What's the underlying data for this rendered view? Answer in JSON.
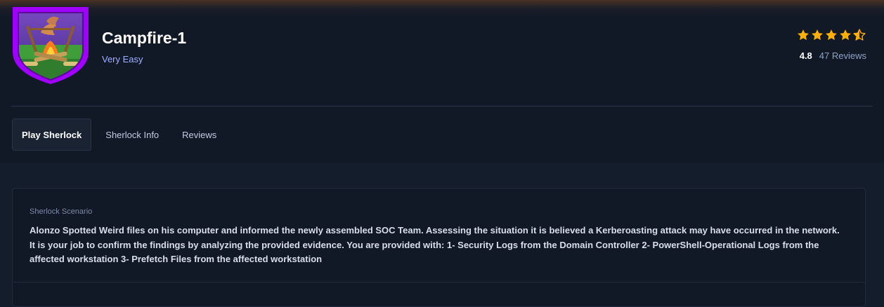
{
  "machine": {
    "title": "Campfire-1",
    "difficulty": "Very Easy",
    "rating": "4.8",
    "reviews": "47 Reviews",
    "stars": 4.5,
    "badge_icon": "campfire-badge-icon"
  },
  "tabs": [
    {
      "label": "Play Sherlock",
      "active": true
    },
    {
      "label": "Sherlock Info",
      "active": false
    },
    {
      "label": "Reviews",
      "active": false
    }
  ],
  "scenario": {
    "label": "Sherlock Scenario",
    "text": "Alonzo Spotted Weird files on his computer and informed the newly assembled SOC Team. Assessing the situation it is believed a Kerberoasting attack may have occurred in the network. It is your job to confirm the findings by analyzing the provided evidence. You are provided with: 1- Security Logs from the Domain Controller 2- PowerShell-Operational Logs from the affected workstation 3- Prefetch Files from the affected workstation"
  },
  "colors": {
    "background": "#141d2b",
    "header_bg": "#111927",
    "accent_blue": "#9fb0ff",
    "star": "#ffaf00",
    "badge_purple": "#9f00ff"
  }
}
